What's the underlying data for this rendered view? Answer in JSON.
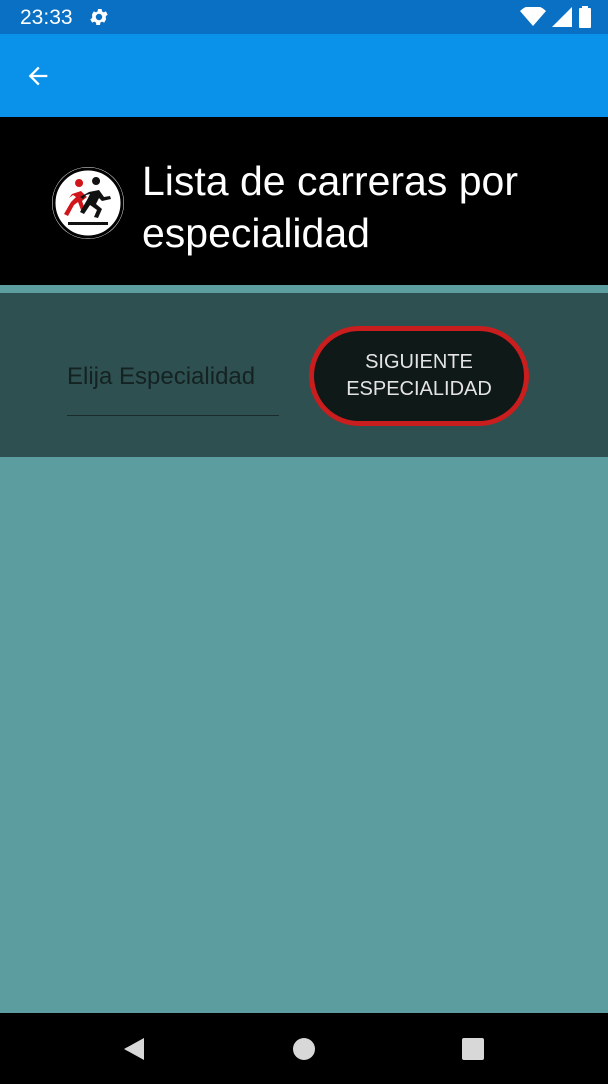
{
  "status_bar": {
    "time": "23:33",
    "icons": [
      "settings-gear-icon",
      "wifi-icon",
      "cell-signal-icon",
      "battery-icon"
    ]
  },
  "app_bar": {
    "back_icon": "arrow-back-icon"
  },
  "header": {
    "title": "Lista de carreras por especialidad",
    "logo_icon": "runners-logo-icon"
  },
  "controls": {
    "picker_label": "Elija Especialidad",
    "next_button_label": "SIGUIENTE ESPECIALIDAD"
  },
  "nav_bar": {
    "icons": [
      "back-triangle-icon",
      "home-circle-icon",
      "recents-square-icon"
    ]
  },
  "colors": {
    "status_bar": "#0a70c4",
    "app_bar": "#0a92ea",
    "header_bg": "#000000",
    "panel_bg": "#2f5051",
    "content_bg": "#5c9e9f",
    "button_border": "#c91d1e"
  }
}
